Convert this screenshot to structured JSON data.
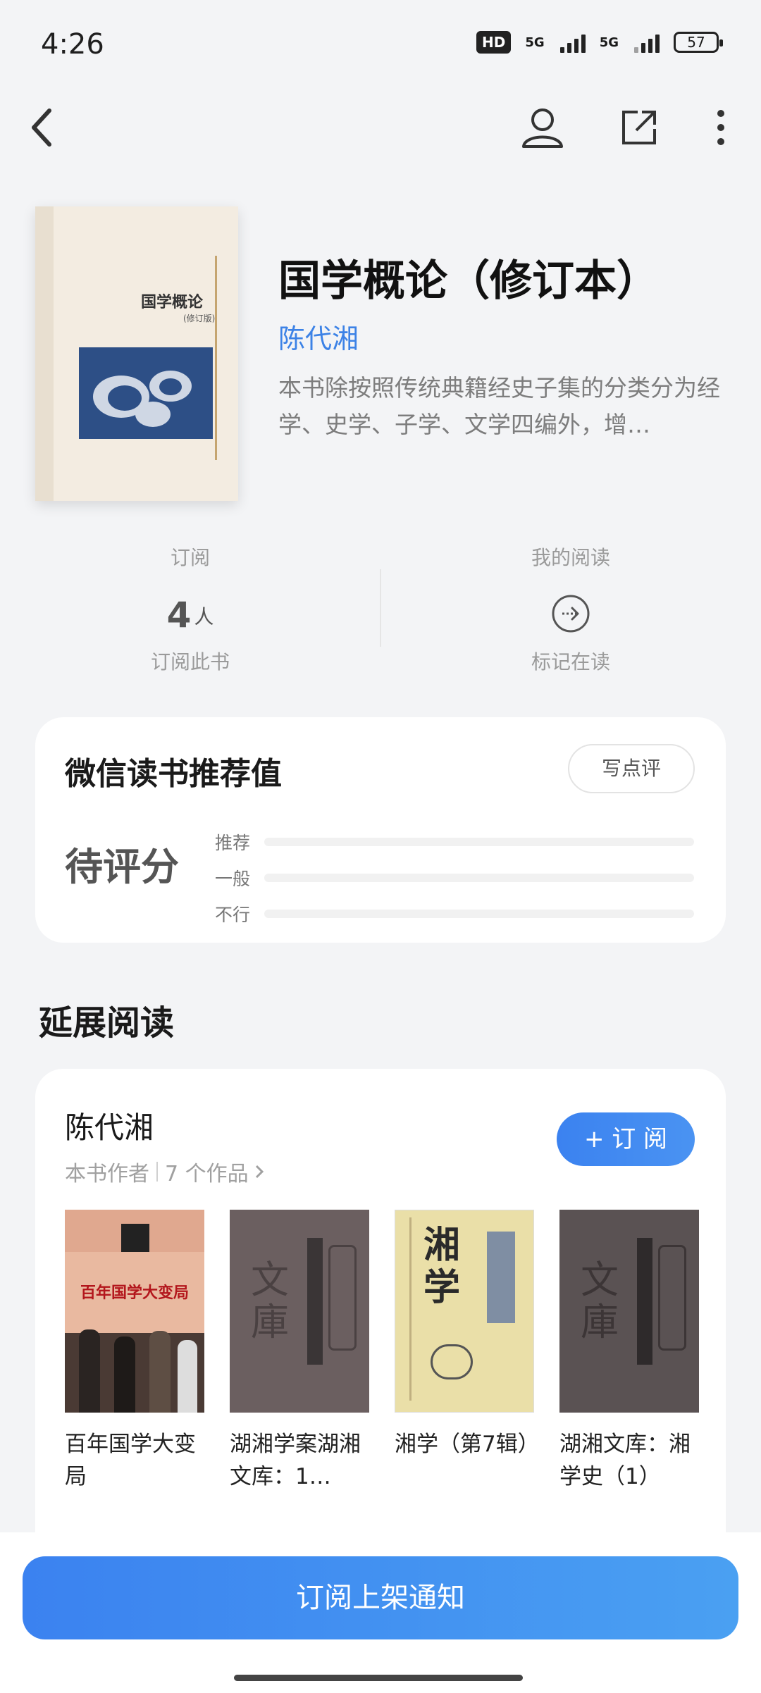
{
  "status": {
    "time": "4:26",
    "hd": "HD",
    "net1": "5G",
    "net2": "5G",
    "battery": "57"
  },
  "nav": {
    "back_icon": "back-arrow-icon",
    "profile_icon": "person-icon",
    "share_icon": "share-icon",
    "more_icon": "more-vertical-icon"
  },
  "book": {
    "cover_title": "国学概论",
    "cover_subtitle": "(修订版)",
    "title": "国学概论（修订本）",
    "author": "陈代湘",
    "description": "本书除按照传统典籍经史子集的分类分为经学、史学、子学、文学四编外，增…"
  },
  "stats": {
    "subscribe": {
      "label": "订阅",
      "count": "4",
      "unit": "人",
      "sub": "订阅此书"
    },
    "reading": {
      "label": "我的阅读",
      "icon": "arrow-circle-icon",
      "sub": "标记在读"
    }
  },
  "rating": {
    "title": "微信读书推荐值",
    "write_label": "写点评",
    "score": "待评分",
    "rows": [
      {
        "label": "推荐",
        "value": 0
      },
      {
        "label": "一般",
        "value": 0
      },
      {
        "label": "不行",
        "value": 0
      }
    ]
  },
  "extended": {
    "title": "延展阅读",
    "author": {
      "name": "陈代湘",
      "role": "本书作者",
      "works_count": "7 个作品",
      "subscribe_label": "+ 订 阅"
    },
    "works": [
      {
        "title": "百年国学大变局",
        "cover_text": "百年国学大变局"
      },
      {
        "title": "湖湘学案湖湘文库：1…",
        "cover_text": "文庫"
      },
      {
        "title": "湘学（第7辑）",
        "cover_text": "湘学"
      },
      {
        "title": "湖湘文库：湘学史（1）",
        "cover_text": "文庫"
      }
    ]
  },
  "bottom": {
    "notify_label": "订阅上架通知"
  }
}
